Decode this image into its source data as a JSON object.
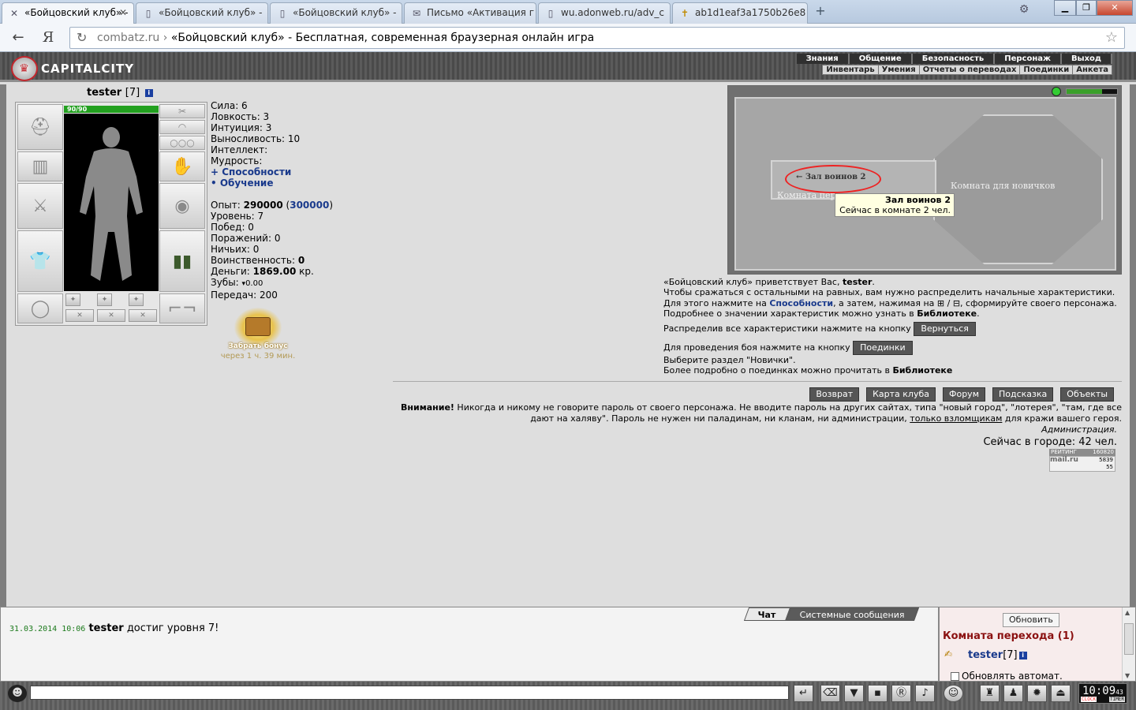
{
  "browser": {
    "tabs": [
      {
        "title": "«Бойцовский клуб» -",
        "active": true
      },
      {
        "title": "«Бойцовский клуб» -",
        "active": false
      },
      {
        "title": "«Бойцовский клуб» -",
        "active": false
      },
      {
        "title": "Письмо «Активация г",
        "active": false
      },
      {
        "title": "wu.adonweb.ru/adv_c",
        "active": false
      },
      {
        "title": "ab1d1eaf3a1750b26e8",
        "active": false
      }
    ],
    "url_domain": "combatz.ru",
    "url_sep": "›",
    "page_title": "«Бойцовский клуб» - Бесплатная, современная браузерная онлайн игра"
  },
  "header": {
    "logo": "CAPITALCITY",
    "menu": [
      "Знания",
      "Общение",
      "Безопасность",
      "Персонаж",
      "Выход"
    ],
    "submenu": [
      "Инвентарь",
      "Умения",
      "Отчеты о переводах",
      "Поединки",
      "Анкета"
    ]
  },
  "character": {
    "name": "tester",
    "level": "[7]",
    "hp": "90/90"
  },
  "stats": {
    "strength": "Сила: 6",
    "agility": "Ловкость: 3",
    "intuition": "Интуиция: 3",
    "endurance": "Выносливость: 10",
    "intellect": "Интеллект:",
    "wisdom": "Мудрость:",
    "abilities_link": "+ Способности",
    "training_link": "• Обучение",
    "exp_label": "Опыт: ",
    "exp_value": "290000",
    "exp_next": "300000",
    "level_row": "Уровень: 7",
    "wins": "Побед: 0",
    "losses": "Поражений: 0",
    "draws": "Ничьих: 0",
    "valor_label": "Воинственность: ",
    "valor_value": "0",
    "money_label": "Деньги: ",
    "money_value": "1869.00",
    "money_unit": " кр.",
    "teeth_label": "Зубы: ",
    "teeth_value": "0.00",
    "transfers": "Передач: 200"
  },
  "bonus": {
    "label": "Забрать бонус",
    "timer": "через 1 ч. 39 мин."
  },
  "map": {
    "room_left": "Комната перехода",
    "room_right": "Комната для новичков",
    "hall_label": "← Зал воинов 2",
    "tooltip_title": "Зал воинов 2",
    "tooltip_text": "Сейчас в комнате 2 чел."
  },
  "welcome": {
    "l1a": "«Бойцовский клуб» приветствует Вас, ",
    "l1b": "tester",
    "l2": "Чтобы сражаться с остальными на равных, вам нужно распределить начальные характеристики.",
    "l3a": "Для этого нажмите на ",
    "l3b": "Способности",
    "l3c": ", а затем, нажимая на ⊞ / ⊟, сформируйте своего персонажа.",
    "l4a": "Подробнее о значении характеристик можно узнать в ",
    "l4b": "Библиотеке",
    "l5": "Распределив все характеристики нажмите на кнопку ",
    "btn_return": "Вернуться",
    "l6": "Для проведения боя нажмите на кнопку ",
    "btn_duels": "Поединки",
    "l7": "Выберите раздел \"Новички\".",
    "l8a": "Более подробно о поединках можно прочитать в ",
    "l8b": "Библиотеке"
  },
  "nav_buttons": [
    "Возврат",
    "Карта клуба",
    "Форум",
    "Подсказка",
    "Объекты"
  ],
  "warning": {
    "bold": "Внимание!",
    "text1": " Никогда и никому не говорите пароль от своего персонажа. Не вводите пароль на других сайтах, типа \"новый город\", \"лотерея\", \"там, где все дают на халяву\". Пароль не нужен ни паладинам, ни кланам, ни администрации, ",
    "link": "только взломщикам",
    "text2": " для кражи вашего героя.",
    "admin": "Администрация.",
    "online": "Сейчас в городе: 42 чел."
  },
  "counter": {
    "label": "РЕЙТИНГ",
    "v1": "160820",
    "v2": "5839",
    "v3": "55",
    "brand": "mail.ru"
  },
  "chat": {
    "tab_chat": "Чат",
    "tab_system": "Системные сообщения",
    "msg_time": "31.03.2014 10:06",
    "msg_user": "tester",
    "msg_text": " достиг уровня 7!"
  },
  "room": {
    "refresh": "Обновить",
    "title": "Комната перехода (1)",
    "user": "tester",
    "user_level": "[7]",
    "auto": "Обновлять автомат."
  },
  "clock": {
    "time": "10:09",
    "sec": "43",
    "label1": "CLOCK",
    "label2": "TIMER"
  }
}
